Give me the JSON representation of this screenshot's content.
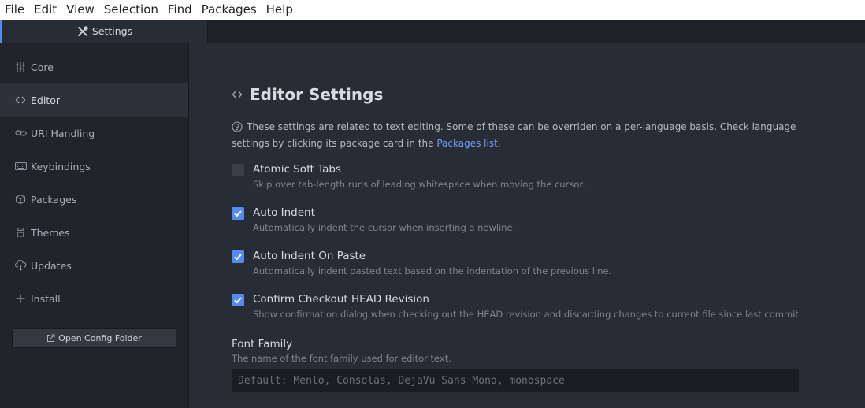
{
  "menubar": {
    "items": [
      "File",
      "Edit",
      "View",
      "Selection",
      "Find",
      "Packages",
      "Help"
    ]
  },
  "tab": {
    "label": "Settings",
    "icon": "tools-icon"
  },
  "sidebar": {
    "items": [
      {
        "label": "Core",
        "icon": "sliders-icon"
      },
      {
        "label": "Editor",
        "icon": "code-icon",
        "active": true
      },
      {
        "label": "URI Handling",
        "icon": "link-icon"
      },
      {
        "label": "Keybindings",
        "icon": "keyboard-icon"
      },
      {
        "label": "Packages",
        "icon": "package-icon"
      },
      {
        "label": "Themes",
        "icon": "paintcan-icon"
      },
      {
        "label": "Updates",
        "icon": "cloud-download-icon"
      },
      {
        "label": "Install",
        "icon": "plus-icon"
      }
    ],
    "config_button": "Open Config Folder"
  },
  "main": {
    "title": "Editor Settings",
    "description_text": "These settings are related to text editing. Some of these can be overriden on a per-language basis. Check language settings by clicking its package card in the ",
    "description_link": "Packages list",
    "description_end": ".",
    "settings": [
      {
        "label": "Atomic Soft Tabs",
        "help": "Skip over tab-length runs of leading whitespace when moving the cursor.",
        "checked": false
      },
      {
        "label": "Auto Indent",
        "help": "Automatically indent the cursor when inserting a newline.",
        "checked": true
      },
      {
        "label": "Auto Indent On Paste",
        "help": "Automatically indent pasted text based on the indentation of the previous line.",
        "checked": true
      },
      {
        "label": "Confirm Checkout HEAD Revision",
        "help": "Show confirmation dialog when checking out the HEAD revision and discarding changes to current file since last commit.",
        "checked": true
      }
    ],
    "font_family": {
      "label": "Font Family",
      "help": "The name of the font family used for editor text.",
      "placeholder": "Default: Menlo, Consolas, DejaVu Sans Mono, monospace"
    }
  },
  "colors": {
    "accent": "#568af2",
    "link": "#6c9ef8",
    "background": "#282c34",
    "sidebar": "#21252b"
  }
}
